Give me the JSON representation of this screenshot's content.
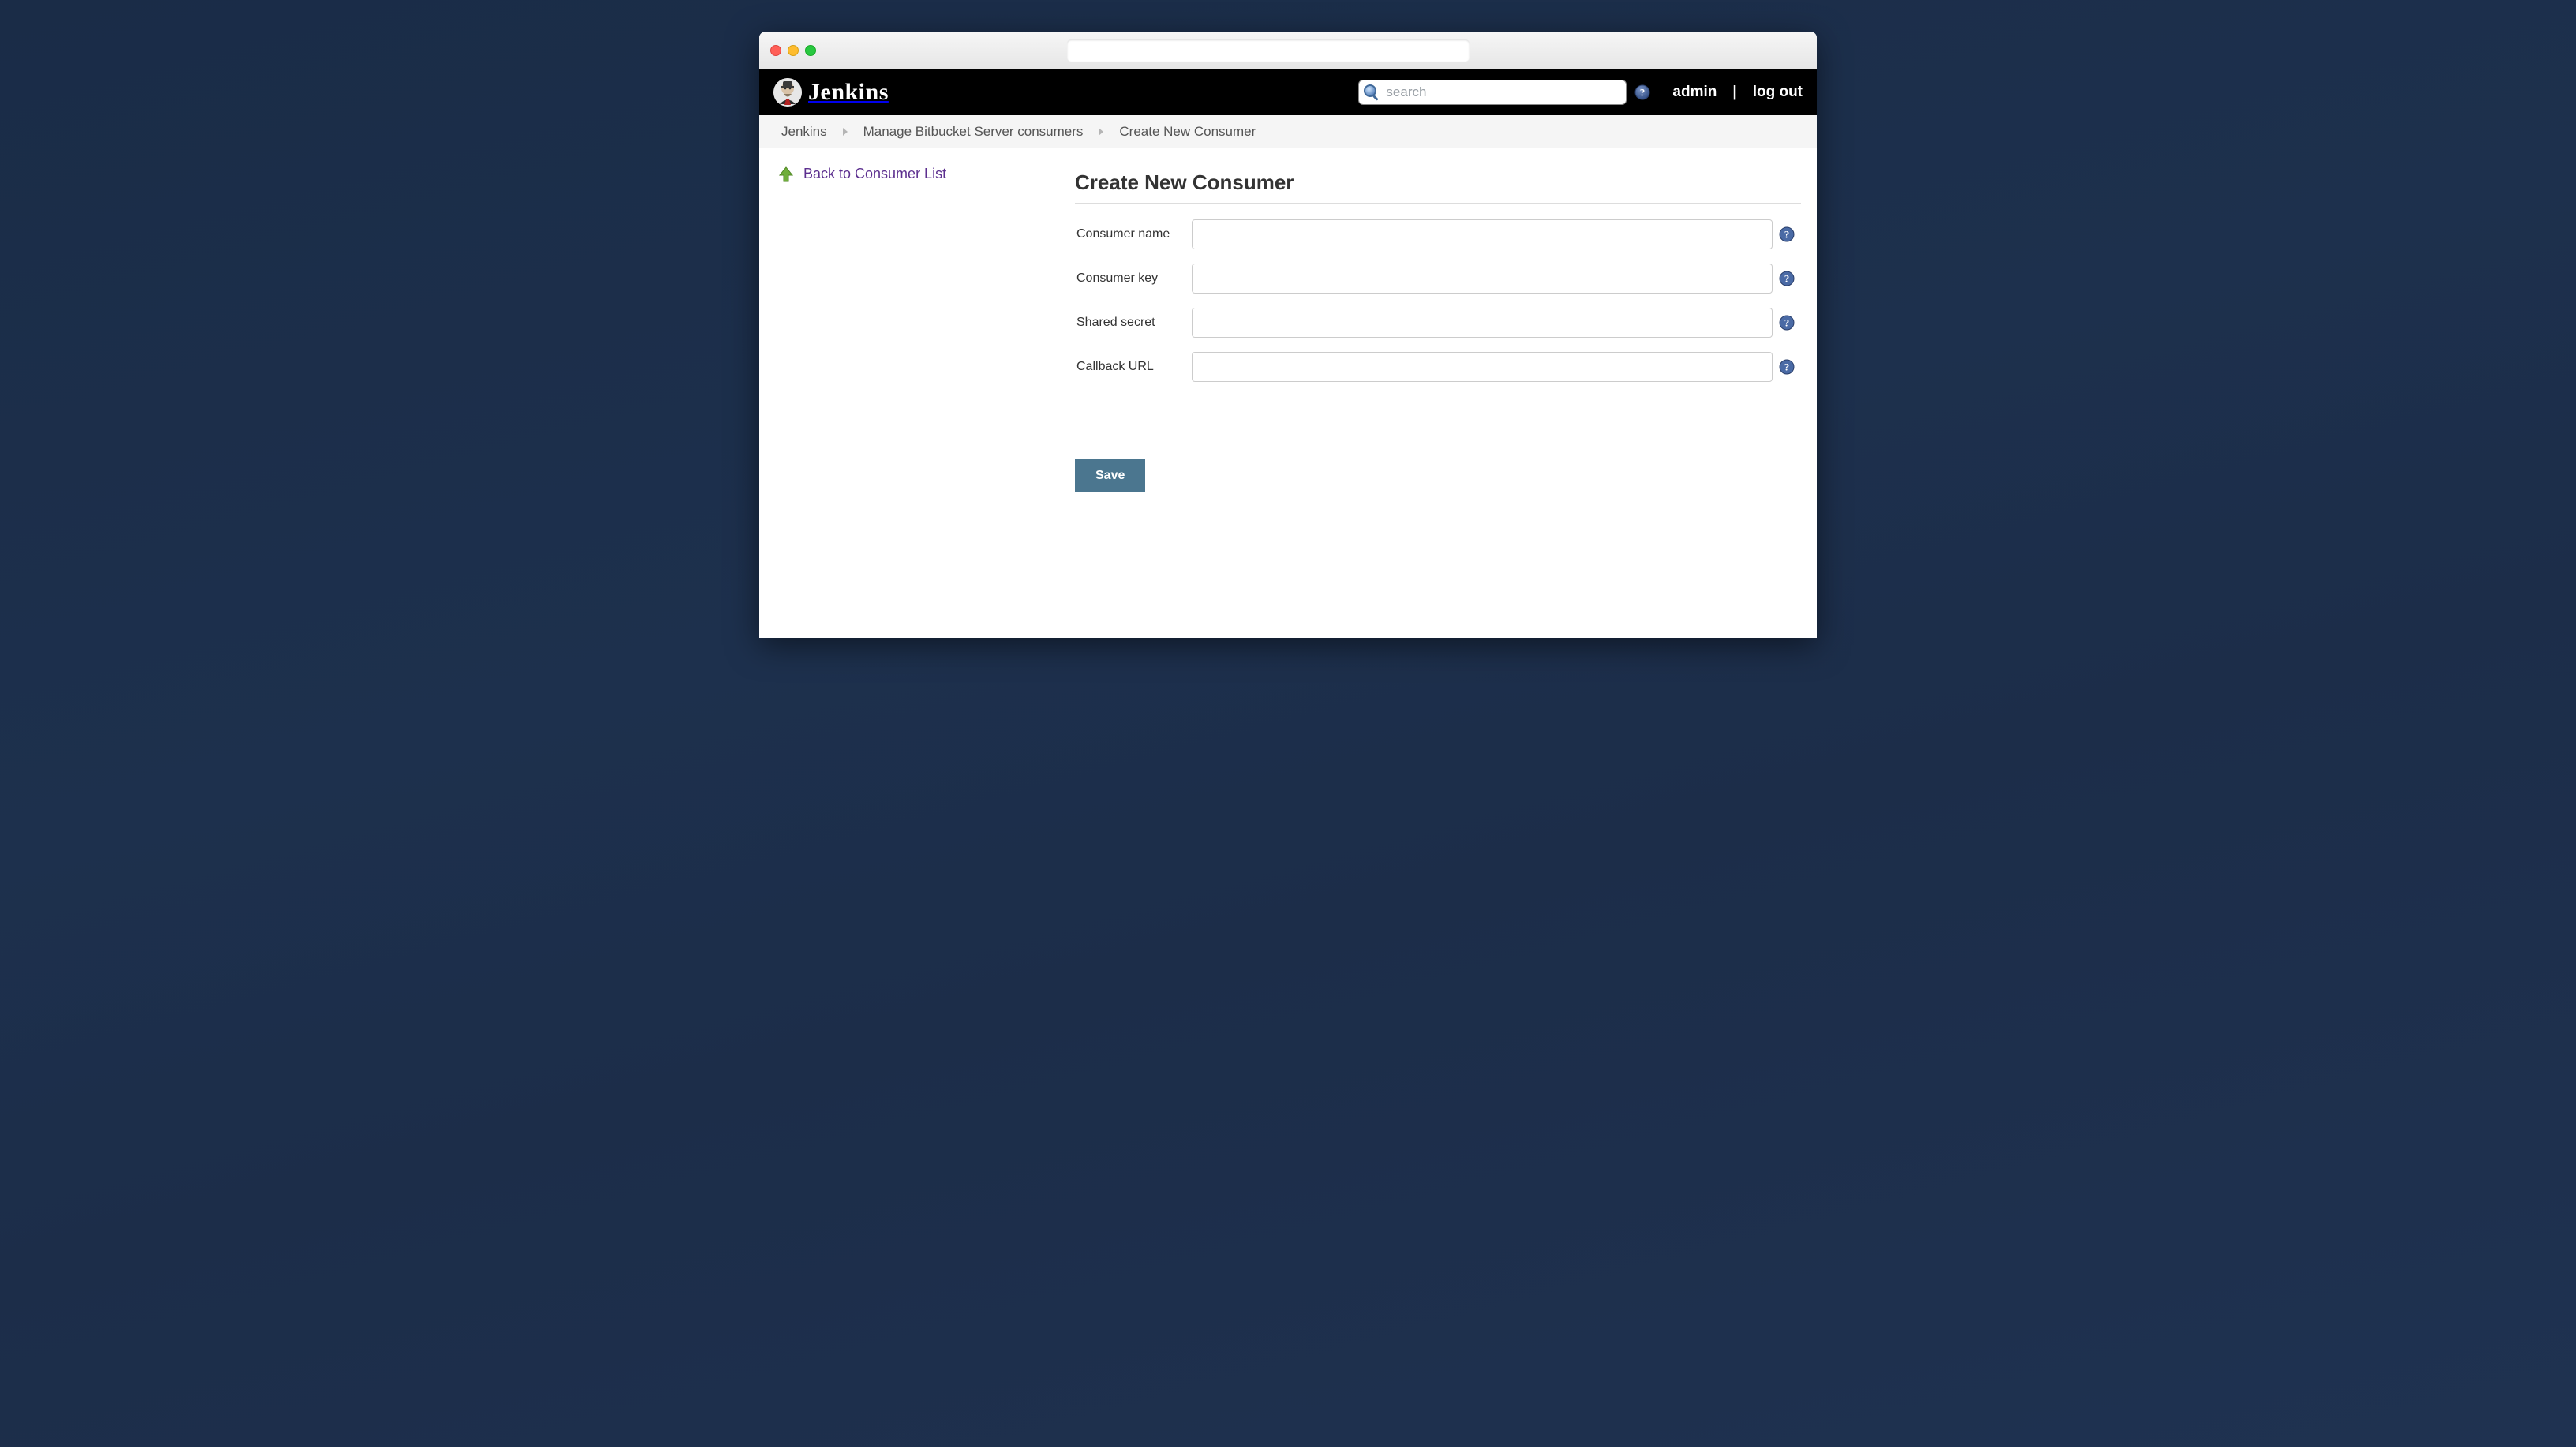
{
  "header": {
    "brand": "Jenkins",
    "search_placeholder": "search",
    "user_label": "admin",
    "logout_label": "log out"
  },
  "breadcrumb": {
    "items": [
      "Jenkins",
      "Manage Bitbucket Server consumers",
      "Create New Consumer"
    ]
  },
  "side": {
    "back_label": "Back to Consumer List"
  },
  "main": {
    "heading": "Create New Consumer",
    "fields": [
      {
        "label": "Consumer name",
        "value": ""
      },
      {
        "label": "Consumer key",
        "value": ""
      },
      {
        "label": "Shared secret",
        "value": ""
      },
      {
        "label": "Callback URL",
        "value": ""
      }
    ],
    "save_label": "Save"
  }
}
